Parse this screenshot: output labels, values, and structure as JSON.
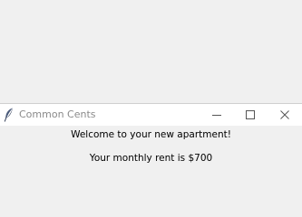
{
  "window": {
    "title": "Common Cents",
    "icon": "feather-icon",
    "controls": [
      "minimize-icon",
      "maximize-icon",
      "close-icon"
    ]
  },
  "content": {
    "welcome_text": "Welcome to your new apartment!",
    "rent_text": "Your monthly rent is $700"
  }
}
